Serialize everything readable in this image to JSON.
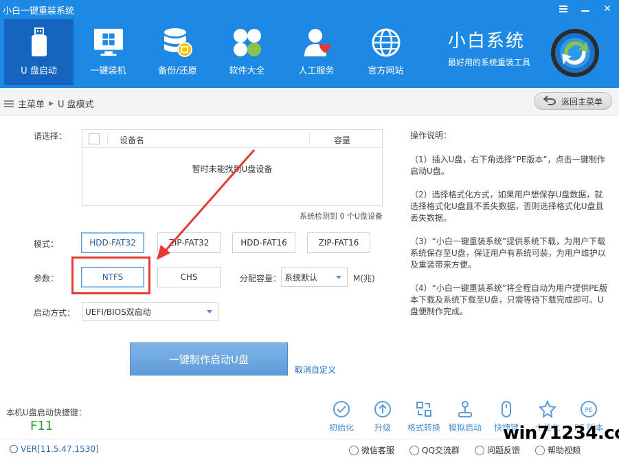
{
  "app_title": "小白一键重装系统",
  "nav": [
    {
      "label": "U 盘启动",
      "icon": "usb-icon",
      "active": true
    },
    {
      "label": "一键装机",
      "icon": "windows-icon",
      "active": false
    },
    {
      "label": "备份/还原",
      "icon": "database-icon",
      "active": false
    },
    {
      "label": "软件大全",
      "icon": "apps-icon",
      "active": false
    },
    {
      "label": "人工服务",
      "icon": "user-heart-icon",
      "active": false
    },
    {
      "label": "官方网站",
      "icon": "globe-icon",
      "active": false
    }
  ],
  "brand": {
    "title": "小白系统",
    "subtitle": "最好用的系统重装工具"
  },
  "breadcrumb": {
    "root": "主菜单",
    "current": "U 盘模式"
  },
  "back_button": "返回主菜单",
  "select_label": "请选择：",
  "device_table": {
    "col_name": "设备名",
    "col_capacity": "容量",
    "empty": "暂时未能找到U盘设备",
    "status": "系统检测到 0 个U盘设备"
  },
  "mode": {
    "label": "模式：",
    "options": [
      "HDD-FAT32",
      "ZIP-FAT32",
      "HDD-FAT16",
      "ZIP-FAT16"
    ],
    "selected": "HDD-FAT32"
  },
  "params": {
    "label": "参数：",
    "options": [
      "NTFS",
      "CHS"
    ],
    "selected": "NTFS",
    "alloc_label": "分配容量：",
    "alloc_value": "系统默认",
    "alloc_unit": "M(兆)"
  },
  "boot": {
    "label": "启动方式：",
    "value": "UEFI/BIOS双启动"
  },
  "make_button": "一键制作启动U盘",
  "cancel_link": "取消自定义",
  "instructions": {
    "title": "操作说明：",
    "steps": [
      "（1）插入U盘，右下角选择“PE版本”，点击一键制作启动U盘。",
      "（2）选择格式化方式，如果用户想保存U盘数据，就选择格式化U盘且不丢失数据，否则选择格式化U盘且丢失数据。",
      "（3）“小白一键重装系统”提供系统下载，为用户下载系统保存至U盘，保证用户有系统可装，为用户维护以及重装带来方便。",
      "（4）“小白一键重装系统”将全程自动为用户提供PE版本下载及系统下载至U盘，只需等待下载完成即可。U盘便制作完成。"
    ]
  },
  "hotkey": {
    "label": "本机U盘启动快捷键：",
    "value": "F11"
  },
  "tools": [
    {
      "label": "初始化",
      "icon": "check-circle-icon"
    },
    {
      "label": "升级",
      "icon": "upgrade-icon"
    },
    {
      "label": "格式转换",
      "icon": "convert-icon"
    },
    {
      "label": "模拟启动",
      "icon": "joystick-icon"
    },
    {
      "label": "快捷键",
      "icon": "mouse-icon"
    },
    {
      "label": "个性化",
      "icon": "personalize-icon"
    },
    {
      "label": "PE 版本",
      "icon": "pe-icon"
    }
  ],
  "footer": {
    "version": "VER[11.5.47.1530]",
    "links": [
      "微信客服",
      "QQ交流群",
      "问题反馈",
      "帮助视频"
    ]
  },
  "watermark": "win71234.com",
  "colors": {
    "header": "#1e88e5",
    "nav_active": "#1565c0",
    "accent": "#5a9bd8",
    "highlight": "#e53935",
    "hotkey": "#2e9a3a"
  }
}
